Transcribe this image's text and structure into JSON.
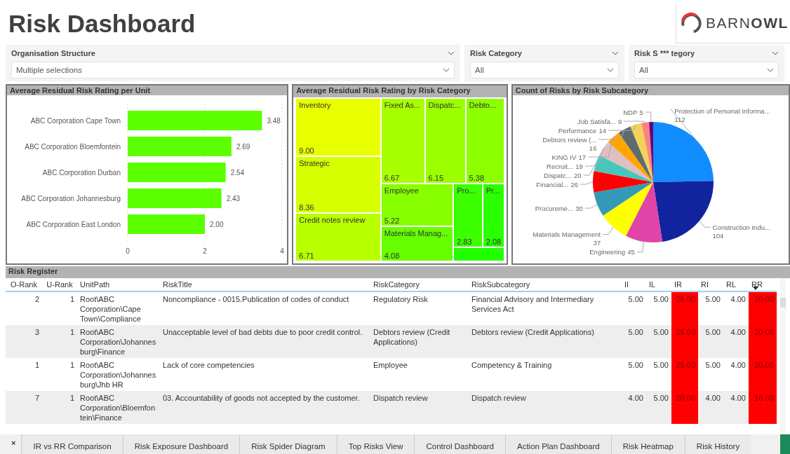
{
  "header": {
    "title": "Risk Dashboard",
    "logo": "BARN**OWL**"
  },
  "filters": [
    {
      "label": "Organisation Structure",
      "value": "Multiple selections"
    },
    {
      "label": "Risk Category",
      "value": "All"
    },
    {
      "label": "Risk S *** tegory",
      "value": "All"
    }
  ],
  "unit_chart": {
    "title": "Average Residual Risk Rating per Unit",
    "chart_data": {
      "type": "bar",
      "orientation": "horizontal",
      "categories": [
        "ABC Corporation Cape Town",
        "ABC Corporation Bloemfontein",
        "ABC Corporation Durban",
        "ABC Corporation Johannesburg",
        "ABC Corporation East London"
      ],
      "series": [
        {
          "color": "#5cff00",
          "values": [
            3.48,
            2.69,
            2.54,
            2.43,
            2.0
          ]
        }
      ],
      "xlim": [
        0,
        4
      ],
      "xticks": [
        0,
        2,
        4
      ],
      "value_labels": [
        "3.48",
        "2.69",
        "2.54",
        "2.43",
        "2.00"
      ]
    }
  },
  "category_chart": {
    "title": "Average Residual Risk Rating by Risk Category",
    "tiles": [
      {
        "label": "Inventory",
        "rating": "9.00",
        "color": "#e8ff00"
      },
      {
        "label": "Strategic",
        "rating": "8.36",
        "color": "#d6ff00"
      },
      {
        "label": "Credit notes review",
        "rating": "6.71",
        "color": "#b8ff00"
      },
      {
        "label": "Fixed As...",
        "rating": "6.67",
        "color": "#a8ff00"
      },
      {
        "label": "Dispatc...",
        "rating": "6.15",
        "color": "#9cff00"
      },
      {
        "label": "Debto...",
        "rating": "5.38",
        "color": "#8cff00"
      },
      {
        "label": "Employee",
        "rating": "5.22",
        "color": "#88ff00"
      },
      {
        "label": "Materials Manag...",
        "rating": "4.08",
        "color": "#66ff00"
      },
      {
        "label": "Pro...",
        "rating": "2.83",
        "color": "#3cff00"
      },
      {
        "label": "Pr...",
        "rating": "2.08",
        "color": "#2aff00"
      },
      {
        "color": "#22ff00"
      }
    ]
  },
  "subcategory_chart": {
    "title": "Count of Risks by Risk Subcategory",
    "chart_data": {
      "type": "pie",
      "categories": [
        "Protection of Personal Informa...",
        "Construction Indu...",
        "Engineering",
        "Materials Management",
        "Procureme...",
        "Financial...",
        "Dispatc...",
        "Recruit...",
        "KING IV",
        "Debtors review (...",
        "Performance",
        "Job Satisfa...",
        "NDP"
      ],
      "series": [
        {
          "values": [
            112,
            104,
            45,
            37,
            30,
            26,
            20,
            19,
            17,
            16,
            14,
            9,
            5
          ]
        }
      ],
      "colors": [
        "#118dff",
        "#12239e",
        "#e044a7",
        "#ffff00",
        "#3599b8",
        "#ff0000",
        "#4ac5bb",
        "#dfbfbf",
        "#ffa500",
        "#5f6b6d",
        "#f4d25a",
        "#fb8281",
        "#6b007b"
      ],
      "data_labels": true
    }
  },
  "register": {
    "title": "Risk Register",
    "columns": [
      {
        "label": "O-Rank",
        "sorted": false
      },
      {
        "label": "U-Rank",
        "sorted": false
      },
      {
        "label": "UnitPath",
        "sorted": false
      },
      {
        "label": "RiskTitle",
        "sorted": false
      },
      {
        "label": "RiskCategory",
        "sorted": false
      },
      {
        "label": "RiskSubcategory",
        "sorted": false
      },
      {
        "label": "II",
        "sorted": false
      },
      {
        "label": "IL",
        "sorted": false
      },
      {
        "label": "IR",
        "sorted": false
      },
      {
        "label": "RI",
        "sorted": false
      },
      {
        "label": "RL",
        "sorted": false
      },
      {
        "label": "RR",
        "sorted": true
      }
    ],
    "rows": [
      {
        "cells": [
          {
            "text": "2"
          },
          {
            "text": "1"
          },
          {
            "text": "Root\\ABC Corporation\\Cape Town\\Compliance"
          },
          {
            "text": "Noncompliance - 0015.Publication of codes of conduct"
          },
          {
            "text": "Regulatory Risk"
          },
          {
            "text": "Financial Advisory and Intermediary Services Act"
          },
          {
            "text": "5.00"
          },
          {
            "text": "5.00"
          },
          {
            "text": "25.00",
            "color": "#ff0000"
          },
          {
            "text": "5.00"
          },
          {
            "text": "4.00"
          },
          {
            "text": "20.00",
            "color": "#ff0000"
          }
        ]
      },
      {
        "cells": [
          {
            "text": "3"
          },
          {
            "text": "1"
          },
          {
            "text": "Root\\ABC Corporation\\Johannesburg\\Finance"
          },
          {
            "text": "Unacceptable level of bad debts due to poor credit control."
          },
          {
            "text": "Debtors review (Credit Applications)"
          },
          {
            "text": "Debtors review (Credit Applications)"
          },
          {
            "text": "5.00"
          },
          {
            "text": "5.00"
          },
          {
            "text": "25.00",
            "color": "#ff0000"
          },
          {
            "text": "5.00"
          },
          {
            "text": "4.00"
          },
          {
            "text": "20.00",
            "color": "#ff0000"
          }
        ]
      },
      {
        "cells": [
          {
            "text": "1"
          },
          {
            "text": "1"
          },
          {
            "text": "Root\\ABC Corporation\\Johannesburg\\Jhb HR"
          },
          {
            "text": "Lack of core competencies"
          },
          {
            "text": "Employee"
          },
          {
            "text": "Competency & Training"
          },
          {
            "text": "5.00"
          },
          {
            "text": "5.00"
          },
          {
            "text": "25.00",
            "color": "#ff0000"
          },
          {
            "text": "5.00"
          },
          {
            "text": "4.00"
          },
          {
            "text": "20.00",
            "color": "#ff0000"
          }
        ]
      },
      {
        "cells": [
          {
            "text": "7"
          },
          {
            "text": "1"
          },
          {
            "text": "Root\\ABC Corporation\\Bloemfontein\\Finance"
          },
          {
            "text": "03. Accountability of goods not accepted by the customer."
          },
          {
            "text": "Dispatch review"
          },
          {
            "text": "Dispatch review"
          },
          {
            "text": "4.00"
          },
          {
            "text": "5.00"
          },
          {
            "text": "20.00",
            "color": "#ff0000"
          },
          {
            "text": "4.00"
          },
          {
            "text": "4.00"
          },
          {
            "text": "16.00",
            "color": "#ff0000"
          }
        ]
      }
    ]
  },
  "tab_bar": {
    "close": "×",
    "tabs": [
      {
        "label": "IR vs RR Comparison",
        "selected": false
      },
      {
        "label": "Risk Exposure Dashboard",
        "selected": false
      },
      {
        "label": "Risk Spider Diagram",
        "selected": false
      },
      {
        "label": "Top Risks View",
        "selected": false
      },
      {
        "label": "Control Dashboard",
        "selected": false
      },
      {
        "label": "Action Plan Dashboard",
        "selected": false
      },
      {
        "label": "Risk Heatmap",
        "selected": false
      },
      {
        "label": "Risk History",
        "selected": false
      }
    ]
  }
}
